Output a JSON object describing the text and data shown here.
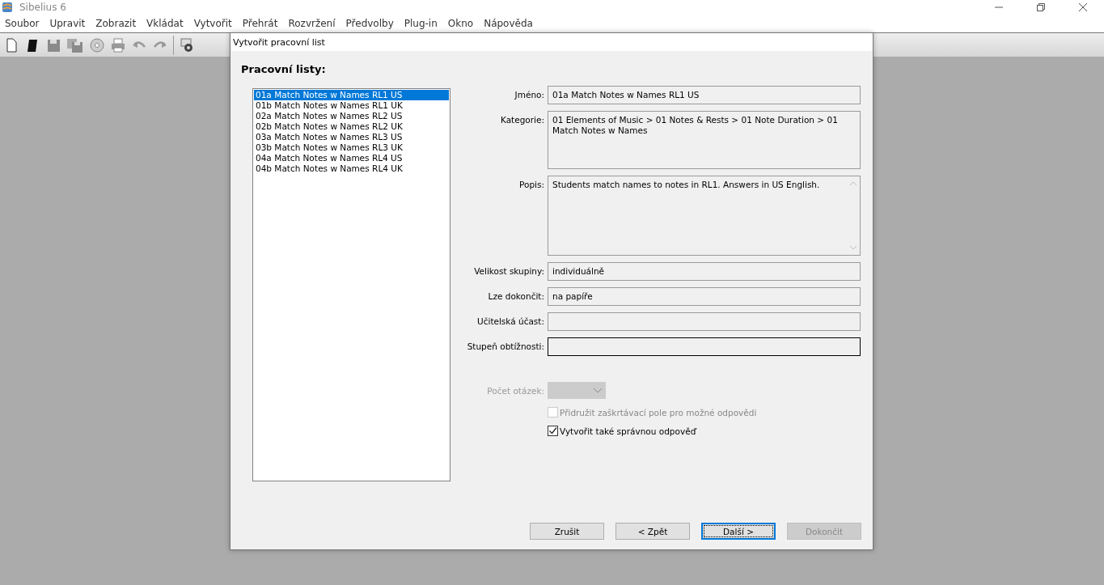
{
  "app": {
    "title": "Sibelius 6"
  },
  "menu": [
    "Soubor",
    "Upravit",
    "Zobrazit",
    "Vkládat",
    "Vytvořit",
    "Přehrát",
    "Rozvržení",
    "Předvolby",
    "Plug-in",
    "Okno",
    "Nápověda"
  ],
  "dialog": {
    "title": "Vytvořit pracovní list",
    "heading": "Pracovní listy:",
    "worksheets": [
      {
        "label": "01a Match Notes w Names RL1 US",
        "selected": true
      },
      {
        "label": "01b Match Notes w Names RL1 UK",
        "selected": false
      },
      {
        "label": "02a Match Notes w Names RL2 US",
        "selected": false
      },
      {
        "label": "02b Match Notes w Names RL2 UK",
        "selected": false
      },
      {
        "label": "03a Match Notes w Names RL3 US",
        "selected": false
      },
      {
        "label": "03b Match Notes w Names RL3 UK",
        "selected": false
      },
      {
        "label": "04a Match Notes w Names RL4 US",
        "selected": false
      },
      {
        "label": "04b Match Notes w Names RL4 UK",
        "selected": false
      }
    ],
    "fields": [
      {
        "label": "Jméno:",
        "value": "01a Match Notes w Names RL1 US",
        "kind": "line",
        "focused": false
      },
      {
        "label": "Kategorie:",
        "value": "01 Elements of Music > 01 Notes & Rests > 01 Note Duration > 01 Match Notes w Names",
        "kind": "area",
        "focused": false
      },
      {
        "label": "Popis:",
        "value": "Students match names to notes in RL1. Answers in US English.",
        "kind": "scroll-area",
        "focused": false
      },
      {
        "label": "Velikost skupiny:",
        "value": "individuálně",
        "kind": "line",
        "focused": false
      },
      {
        "label": "Lze dokončit:",
        "value": "na papíře",
        "kind": "line",
        "focused": false
      },
      {
        "label": "Učitelská účast:",
        "kind": "line",
        "focused": false
      },
      {
        "label": "Stupeň obtížnosti:",
        "kind": "line",
        "focused": true
      }
    ],
    "question_count": {
      "label": "Počet otázek:",
      "disabled": true
    },
    "checkboxes": [
      {
        "label": "Přidružit zaškrtávací pole pro možné odpovědi",
        "checked": false,
        "disabled": true
      },
      {
        "label": "Vytvořit také správnou odpověď",
        "checked": true,
        "disabled": false
      }
    ],
    "buttons": [
      {
        "label": "Zrušit",
        "kind": "normal",
        "disabled": false
      },
      {
        "label": "< Zpět",
        "kind": "normal",
        "disabled": false
      },
      {
        "label": "Další >",
        "kind": "default",
        "disabled": false
      },
      {
        "label": "Dokončit",
        "kind": "normal",
        "disabled": true
      }
    ]
  }
}
